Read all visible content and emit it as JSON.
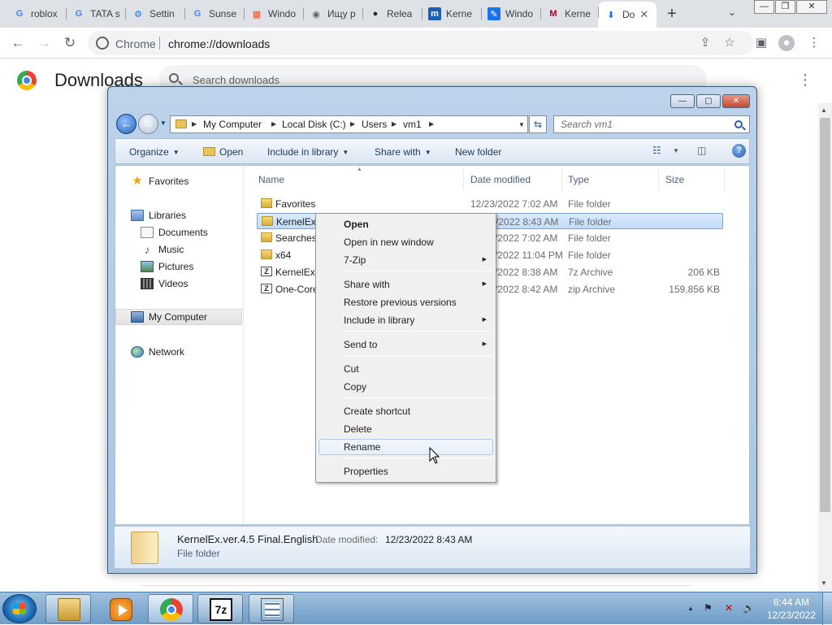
{
  "browser": {
    "tabs": [
      {
        "title": "roblox",
        "icon": "google-icon",
        "fav_text": "G",
        "fav_color": "#4285f4"
      },
      {
        "title": "TATA s",
        "icon": "google-icon",
        "fav_text": "G",
        "fav_color": "#4285f4"
      },
      {
        "title": "Settin",
        "icon": "gear-icon",
        "fav_text": "⚙",
        "fav_color": "#1a73e8"
      },
      {
        "title": "Sunse",
        "icon": "google-icon",
        "fav_text": "G",
        "fav_color": "#4285f4"
      },
      {
        "title": "Windo",
        "icon": "windows-icon",
        "fav_text": "▦",
        "fav_color": "#f25022"
      },
      {
        "title": "Ищу р",
        "icon": "globe-icon",
        "fav_text": "◉",
        "fav_color": "#5f6368"
      },
      {
        "title": "Relea",
        "icon": "github-icon",
        "fav_text": "●",
        "fav_color": "#24292f"
      },
      {
        "title": "Kerne",
        "icon": "kernel-icon",
        "fav_text": "m",
        "fav_color": "#1a5fb4"
      },
      {
        "title": "Windo",
        "icon": "pen-icon",
        "fav_text": "✎",
        "fav_color": "#1a73e8"
      },
      {
        "title": "Kerne",
        "icon": "msfn-icon",
        "fav_text": "M",
        "fav_color": "#b00020"
      },
      {
        "title": "Do",
        "icon": "download-icon",
        "fav_text": "⬇",
        "fav_color": "#1a73e8",
        "active": true
      }
    ],
    "new_tab_label": "+",
    "window_controls": {
      "minimize": "—",
      "maximize": "❐",
      "close": "✕"
    },
    "omnibox": {
      "site": "Chrome",
      "url": "chrome://downloads"
    }
  },
  "downloads_page": {
    "title": "Downloads",
    "search_placeholder": "Search downloads",
    "menu_icon": "⋮"
  },
  "explorer": {
    "window_controls": {
      "minimize": "—",
      "maximize": "▢",
      "close": "✕"
    },
    "breadcrumb": [
      "My Computer",
      "Local Disk (C:)",
      "Users",
      "vm1"
    ],
    "search_placeholder": "Search vm1",
    "toolbar": {
      "organize": "Organize",
      "open": "Open",
      "include_in_library": "Include in library",
      "share_with": "Share with",
      "new_folder": "New folder"
    },
    "nav": {
      "favorites": "Favorites",
      "libraries": "Libraries",
      "documents": "Documents",
      "music": "Music",
      "pictures": "Pictures",
      "videos": "Videos",
      "my_computer": "My Computer",
      "network": "Network"
    },
    "columns": {
      "name": "Name",
      "date": "Date modified",
      "type": "Type",
      "size": "Size"
    },
    "files": [
      {
        "name": "Favorites",
        "date": "12/23/2022 7:02 AM",
        "type": "File folder",
        "size": "",
        "icon": "favorites-folder-icon"
      },
      {
        "name": "KernelEx.ver.4.5 Final.English",
        "date": "12/23/2022 8:43 AM",
        "type": "File folder",
        "size": "",
        "icon": "folder-icon",
        "selected": true
      },
      {
        "name": "Searches",
        "date": "12/23/2022 7:02 AM",
        "type": "File folder",
        "size": "",
        "icon": "folder-icon"
      },
      {
        "name": "x64",
        "date": "12/23/2022 11:04 PM",
        "type": "File folder",
        "size": "",
        "icon": "folder-icon"
      },
      {
        "name": "KernelEx.ver.4.5 Final.English.7z",
        "date": "12/23/2022 8:38 AM",
        "type": "7z Archive",
        "size": "206 KB",
        "icon": "archive-icon"
      },
      {
        "name": "One-Core-API.zip",
        "date": "12/23/2022 8:42 AM",
        "type": "zip Archive",
        "size": "159,856 KB",
        "icon": "archive-icon"
      }
    ],
    "details": {
      "name": "KernelEx.ver.4.5 Final.English",
      "date_label": "Date modified:",
      "date": "12/23/2022 8:43 AM",
      "type": "File folder"
    }
  },
  "context_menu": {
    "items": [
      {
        "label": "Open",
        "bold": true
      },
      {
        "label": "Open in new window"
      },
      {
        "label": "7-Zip",
        "submenu": true
      },
      {
        "label": "Share with",
        "submenu": true
      },
      {
        "label": "Restore previous versions"
      },
      {
        "label": "Include in library",
        "submenu": true
      },
      {
        "label": "Send to",
        "submenu": true
      },
      {
        "label": "Cut"
      },
      {
        "label": "Copy"
      },
      {
        "label": "Create shortcut"
      },
      {
        "label": "Delete"
      },
      {
        "label": "Rename",
        "hovered": true
      },
      {
        "label": "Properties"
      }
    ]
  },
  "taskbar": {
    "apps": [
      "windows-explorer",
      "windows-media-player",
      "google-chrome",
      "7-zip",
      "notepad"
    ],
    "seven_zip_label": "7z",
    "clock_time": "8:44 AM",
    "clock_date": "12/23/2022"
  }
}
